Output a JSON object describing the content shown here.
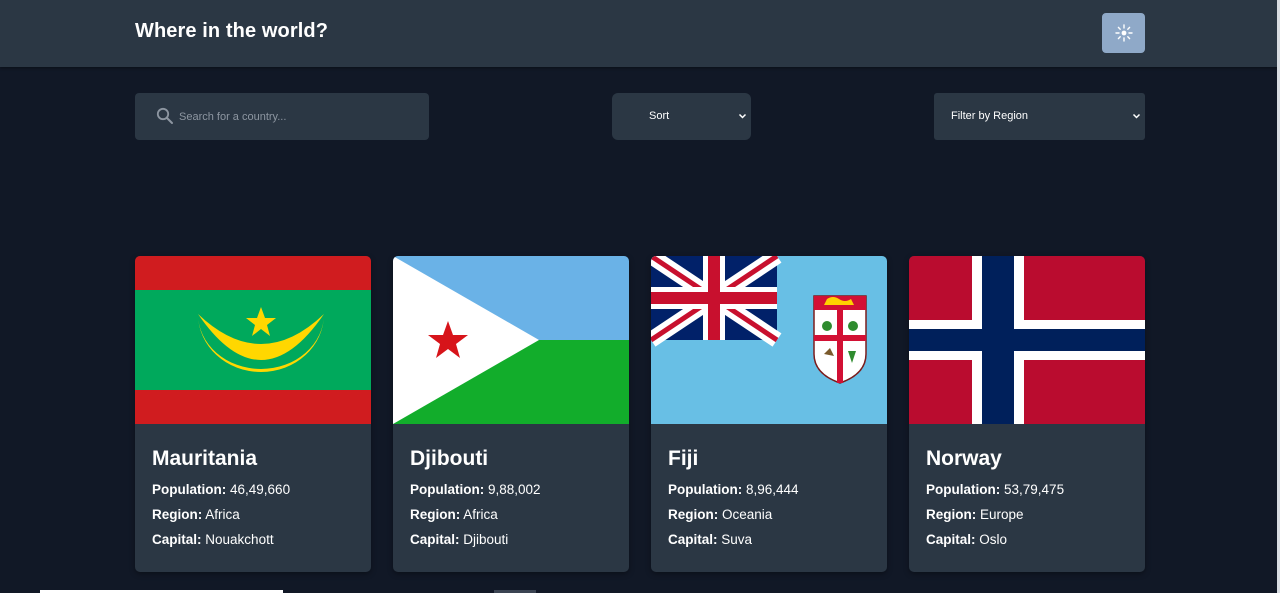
{
  "header": {
    "title": "Where in the world?",
    "theme_toggle_icon": "sun-icon",
    "theme_button_color": "#8fa9c8"
  },
  "search": {
    "placeholder": "Search for a country...",
    "value": ""
  },
  "sort": {
    "label": "Sort"
  },
  "region_filter": {
    "label": "Filter by Region"
  },
  "colors": {
    "background": "#111826",
    "surface": "#2b3744"
  },
  "labels": {
    "population": "Population:",
    "region": "Region:",
    "capital": "Capital:"
  },
  "countries": [
    {
      "name": "Mauritania",
      "population": "46,49,660",
      "region": "Africa",
      "capital": "Nouakchott",
      "flag": "mauritania-flag"
    },
    {
      "name": "Djibouti",
      "population": "9,88,002",
      "region": "Africa",
      "capital": "Djibouti",
      "flag": "djibouti-flag"
    },
    {
      "name": "Fiji",
      "population": "8,96,444",
      "region": "Oceania",
      "capital": "Suva",
      "flag": "fiji-flag"
    },
    {
      "name": "Norway",
      "population": "53,79,475",
      "region": "Europe",
      "capital": "Oslo",
      "flag": "norway-flag"
    }
  ]
}
